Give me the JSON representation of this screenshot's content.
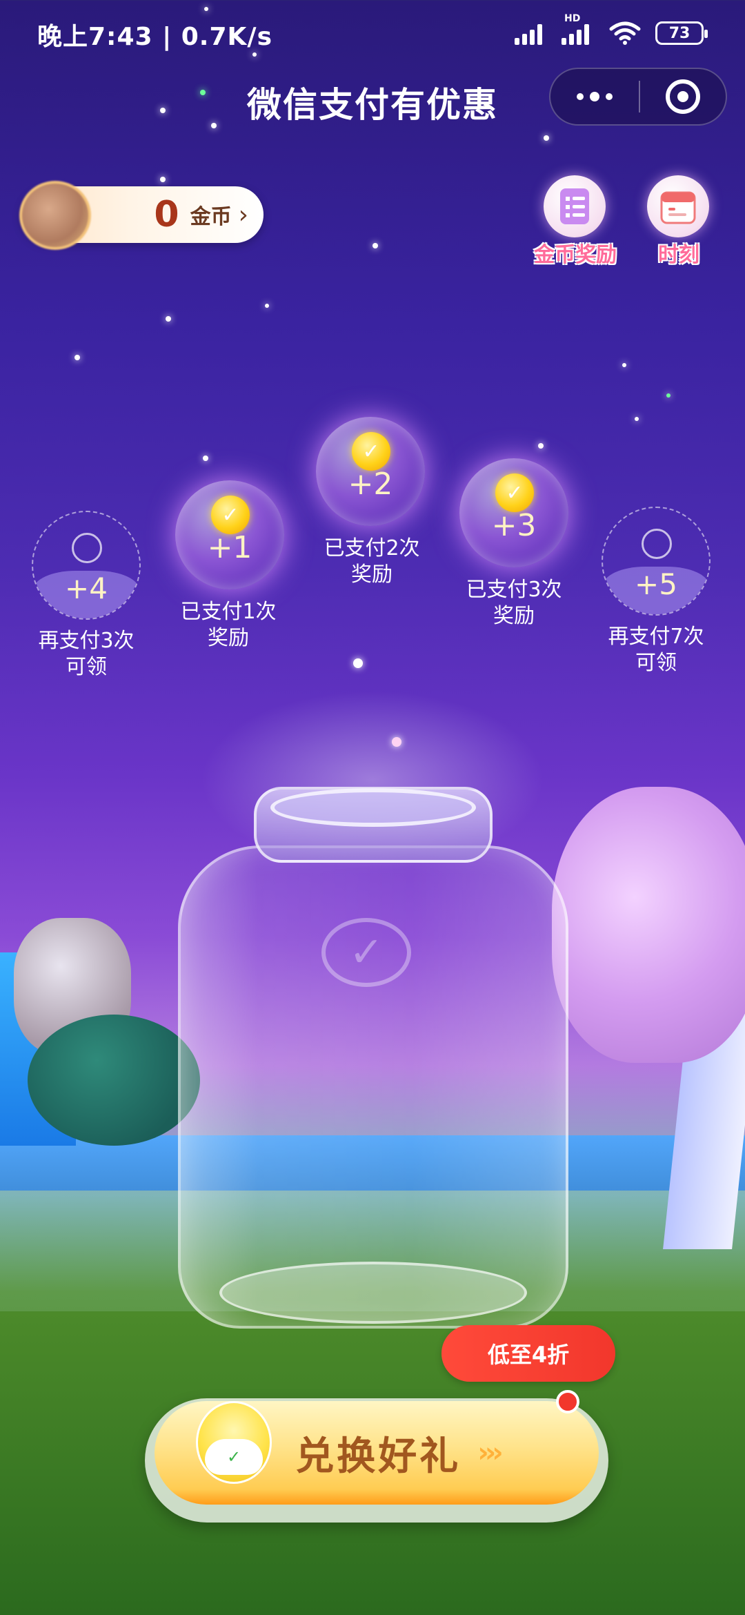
{
  "status_bar": {
    "time_speed": "晚上7:43 | 0.7K/s",
    "network": "HD",
    "battery": "73"
  },
  "header": {
    "title": "微信支付有优惠"
  },
  "coins": {
    "count": "0",
    "unit": "金币",
    "arrow": "›"
  },
  "top_actions": {
    "coin_rewards": "金币奖励",
    "moments": "时刻"
  },
  "rewards": [
    {
      "amount": "+4",
      "caption_line1": "再支付3次",
      "caption_line2": "可领",
      "state": "locked"
    },
    {
      "amount": "+1",
      "caption_line1": "已支付1次",
      "caption_line2": "奖励",
      "state": "available"
    },
    {
      "amount": "+2",
      "caption_line1": "已支付2次",
      "caption_line2": "奖励",
      "state": "available"
    },
    {
      "amount": "+3",
      "caption_line1": "已支付3次",
      "caption_line2": "奖励",
      "state": "available"
    },
    {
      "amount": "+5",
      "caption_line1": "再支付7次",
      "caption_line2": "可领",
      "state": "locked"
    }
  ],
  "redeem": {
    "label": "兑换好礼",
    "discount": "低至4折",
    "arrows": "›››"
  },
  "colors": {
    "accent": "#f2372c",
    "button": "#ffcc52",
    "coin": "#ffd21a"
  }
}
